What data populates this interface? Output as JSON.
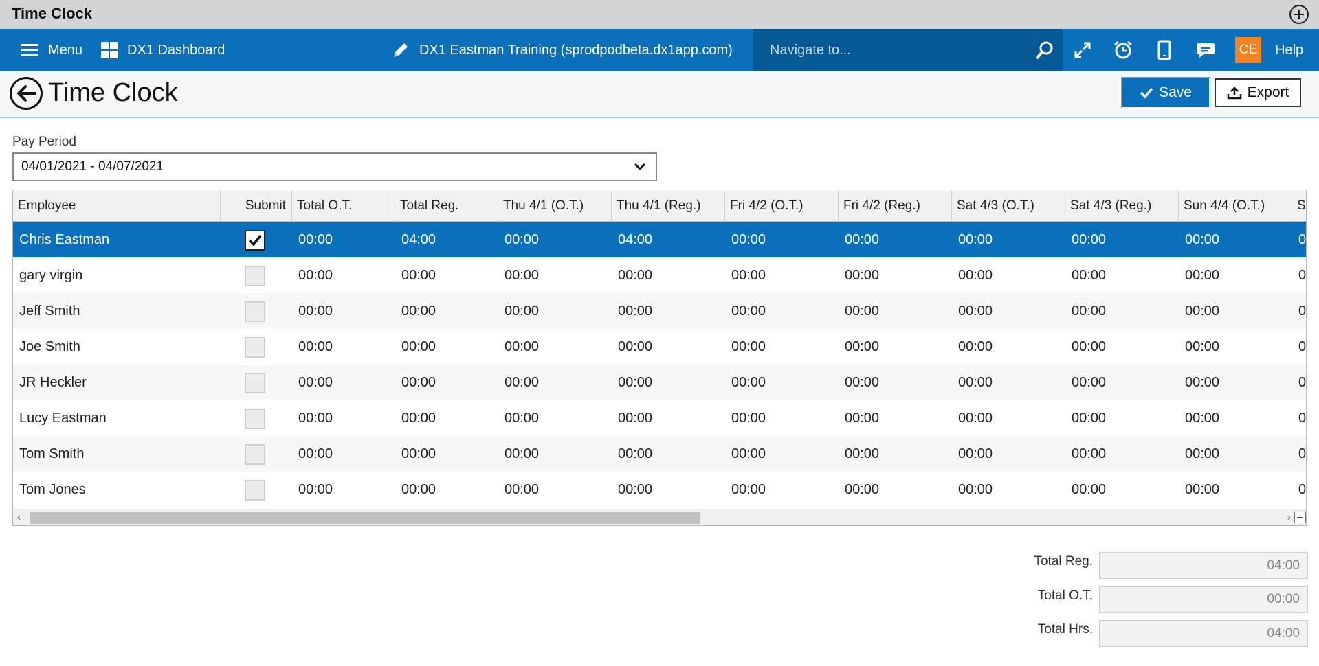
{
  "window": {
    "title": "Time Clock"
  },
  "navbar": {
    "menu_label": "Menu",
    "dashboard_label": "DX1 Dashboard",
    "environment_label": "DX1 Eastman Training (sprodpodbeta.dx1app.com)",
    "search_placeholder": "Navigate to...",
    "avatar_initials": "CE",
    "help_label": "Help",
    "accent_color": "#0a70bb"
  },
  "page": {
    "title": "Time Clock",
    "save_label": "Save",
    "export_label": "Export"
  },
  "pay_period": {
    "label": "Pay Period",
    "value": "04/01/2021 - 04/07/2021"
  },
  "grid": {
    "columns": [
      "Employee",
      "Submit",
      "Total O.T.",
      "Total Reg.",
      "Thu 4/1 (O.T.)",
      "Thu 4/1 (Reg.)",
      "Fri 4/2 (O.T.)",
      "Fri 4/2 (Reg.)",
      "Sat 4/3 (O.T.)",
      "Sat 4/3 (Reg.)",
      "Sun 4/4 (O.T.)",
      "Su"
    ],
    "rows": [
      {
        "employee": "Chris Eastman",
        "submit": true,
        "values": [
          "00:00",
          "04:00",
          "00:00",
          "04:00",
          "00:00",
          "00:00",
          "00:00",
          "00:00",
          "00:00",
          "0"
        ],
        "selected": true
      },
      {
        "employee": "gary virgin",
        "submit": false,
        "values": [
          "00:00",
          "00:00",
          "00:00",
          "00:00",
          "00:00",
          "00:00",
          "00:00",
          "00:00",
          "00:00",
          "0"
        ]
      },
      {
        "employee": "Jeff Smith",
        "submit": false,
        "values": [
          "00:00",
          "00:00",
          "00:00",
          "00:00",
          "00:00",
          "00:00",
          "00:00",
          "00:00",
          "00:00",
          "0"
        ]
      },
      {
        "employee": "Joe Smith",
        "submit": false,
        "values": [
          "00:00",
          "00:00",
          "00:00",
          "00:00",
          "00:00",
          "00:00",
          "00:00",
          "00:00",
          "00:00",
          "0"
        ]
      },
      {
        "employee": "JR Heckler",
        "submit": false,
        "values": [
          "00:00",
          "00:00",
          "00:00",
          "00:00",
          "00:00",
          "00:00",
          "00:00",
          "00:00",
          "00:00",
          "0"
        ]
      },
      {
        "employee": "Lucy Eastman",
        "submit": false,
        "values": [
          "00:00",
          "00:00",
          "00:00",
          "00:00",
          "00:00",
          "00:00",
          "00:00",
          "00:00",
          "00:00",
          "0"
        ]
      },
      {
        "employee": "Tom Smith",
        "submit": false,
        "values": [
          "00:00",
          "00:00",
          "00:00",
          "00:00",
          "00:00",
          "00:00",
          "00:00",
          "00:00",
          "00:00",
          "0"
        ]
      },
      {
        "employee": "Tom Jones",
        "submit": false,
        "values": [
          "00:00",
          "00:00",
          "00:00",
          "00:00",
          "00:00",
          "00:00",
          "00:00",
          "00:00",
          "00:00",
          "0"
        ]
      }
    ]
  },
  "totals": {
    "reg_label": "Total Reg.",
    "reg_value": "04:00",
    "ot_label": "Total O.T.",
    "ot_value": "00:00",
    "hrs_label": "Total Hrs.",
    "hrs_value": "04:00"
  }
}
